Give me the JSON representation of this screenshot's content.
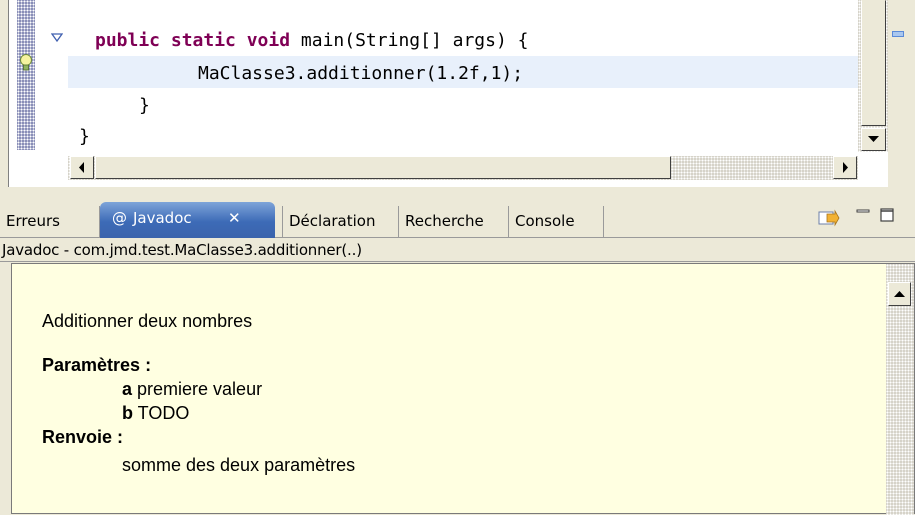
{
  "editor": {
    "code_lines": {
      "line1_keywords": "public static void",
      "line1_rest": " main(String[] args) {",
      "line2": "MaClasse3.additionner(1.2f,1);",
      "line3": "}",
      "line4": "}"
    },
    "highlight_color": "#e8f0fb",
    "keyword_color": "#7f0055"
  },
  "tabs": {
    "erreurs": "Erreurs",
    "javadoc_at": "@",
    "javadoc": "Javadoc",
    "javadoc_close": "✕",
    "declaration": "Déclaration",
    "recherche": "Recherche",
    "console": "Console",
    "active_color": "#3d6bb7"
  },
  "javadoc": {
    "header": "Javadoc - com.jmd.test.MaClasse3.additionner(..)",
    "summary": "Additionner deux nombres",
    "params_heading": "Paramètres :",
    "params": [
      {
        "name": "a",
        "desc": " premiere valeur"
      },
      {
        "name": "b",
        "desc": " TODO"
      }
    ],
    "returns_heading": "Renvoie :",
    "returns_desc": "somme des deux paramètres",
    "background": "#ffffe1"
  }
}
